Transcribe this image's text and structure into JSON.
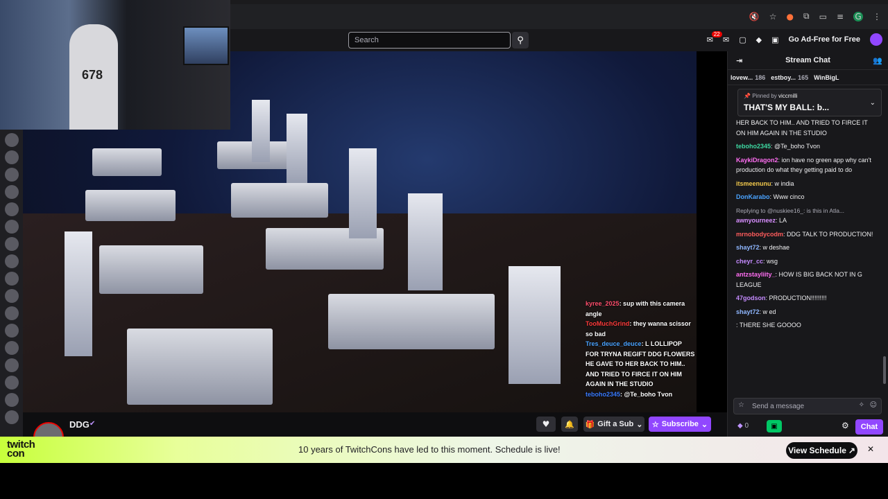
{
  "topnav": {
    "search_placeholder": "Search",
    "notification_count": "22",
    "ad_free_label": "Go Ad-Free for Free"
  },
  "webcam": {
    "jersey_number": "678"
  },
  "overlay_chat": [
    {
      "user": "kyree_2025",
      "text": ": sup with this camera angle",
      "color": "#ff4f6d"
    },
    {
      "user": "TooMuchGrind",
      "text": ": they wanna scissor so bad",
      "color": "#ff3b3b"
    },
    {
      "user": "Tres_deuce_deuce",
      "text": ": L LOLLIPOP FOR TRYNA REGIFT DDG FLOWERS HE GAVE TO HER BACK TO HIM.. AND TRIED TO FIRCE IT ON HIM AGAIN IN THE STUDIO",
      "color": "#4aa3ff"
    },
    {
      "user": "teboho2345",
      "text": ": @Te_boho Tvon",
      "color": "#3a7bff"
    }
  ],
  "channel": {
    "name": "DDG",
    "gift_label": "Gift a Sub",
    "subscribe_label": "Subscribe"
  },
  "chat": {
    "title": "Stream Chat",
    "leaderboard": [
      {
        "name": "lovew...",
        "count": "186"
      },
      {
        "name": "estboy...",
        "count": "165"
      },
      {
        "name": "WinBigL",
        "count": ""
      }
    ],
    "pinned_by": "Pinned by",
    "pinned_user": "viccmilli",
    "pinned_msg": "THAT'S MY BALL: b...",
    "messages": [
      {
        "user": "",
        "color": "#efeff1",
        "text": "HER BACK TO HIM.. AND TRIED TO FIRCE IT ON HIM AGAIN IN THE STUDIO"
      },
      {
        "user": "teboho2345",
        "color": "#3ed9a2",
        "text": ": @Te_boho Tvon"
      },
      {
        "user": "KaykiDragon2",
        "color": "#ff6ef2",
        "text": ": ion have no green app why can't production do what they getting paid to do"
      },
      {
        "user": "itsmeenunu",
        "color": "#f2c94c",
        "text": ": w india"
      },
      {
        "user": "DonKarabo",
        "color": "#4aa3ff",
        "text": ": Www cinco"
      },
      {
        "user": "awnyourneez",
        "color": "#d88fff",
        "text": ": LA",
        "reply": "Replying to @nuskiee16_: is this in Atla..."
      },
      {
        "user": "mrnobodycodm",
        "color": "#ff5c5c",
        "text": ": DDG TALK TO PRODUCTION!"
      },
      {
        "user": "shayt72",
        "color": "#8fb7ff",
        "text": ": w deshae"
      },
      {
        "user": "cheyr_cc",
        "color": "#c58bff",
        "text": ": wsg"
      },
      {
        "user": "antzstayliity_",
        "color": "#ff6ef2",
        "text": ": HOW IS BIG BACK NOT IN G LEAGUE"
      },
      {
        "user": "47godson",
        "color": "#c58bff",
        "text": ": PRODUCTION!!!!!!!!!"
      },
      {
        "user": "shayt72",
        "color": "#8fb7ff",
        "text": ": w ed"
      },
      {
        "user": "",
        "color": "#9147ff",
        "text": ": THERE SHE GOOOO"
      }
    ],
    "send_placeholder": "Send a message",
    "points": "0",
    "chat_button": "Chat"
  },
  "banner": {
    "logo_line1": "twitch",
    "logo_line2": "con",
    "text": "10 years of TwitchCons have led to this moment. Schedule is live!",
    "button": "View Schedule"
  }
}
